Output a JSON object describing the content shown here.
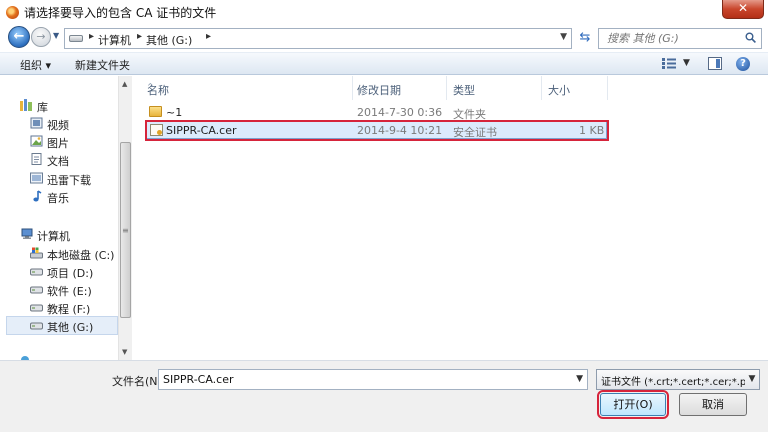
{
  "window": {
    "title": "请选择要导入的包含 CA 证书的文件",
    "close_label": "✕"
  },
  "address_bar": {
    "breadcrumbs": [
      "计算机",
      "其他 (G:)"
    ],
    "search_placeholder": "搜索 其他 (G:)"
  },
  "command_bar": {
    "organize_label": "组织 ▾",
    "new_folder_label": "新建文件夹"
  },
  "navigation": {
    "library_label": "库",
    "libraries": [
      "视频",
      "图片",
      "文档",
      "迅雷下载",
      "音乐"
    ],
    "computer_label": "计算机",
    "drives": [
      "本地磁盘 (C:)",
      "项目 (D:)",
      "软件 (E:)",
      "教程 (F:)",
      "其他 (G:)"
    ],
    "selected_drive": "其他 (G:)"
  },
  "file_list": {
    "columns": [
      "名称",
      "修改日期",
      "类型",
      "大小"
    ],
    "rows": [
      {
        "name": "~1",
        "modified": "2014-7-30 0:36",
        "type": "文件夹",
        "size": "",
        "icon": "folder-icon"
      },
      {
        "name": "SIPPR-CA.cer",
        "modified": "2014-9-4 10:21",
        "type": "安全证书",
        "size": "1 KB",
        "icon": "certificate-icon",
        "selected": true
      }
    ]
  },
  "footer": {
    "filename_label": "文件名(N):",
    "filename_value": "SIPPR-CA.cer",
    "filetype_value": "证书文件 (*.crt;*.cert;*.cer;*.pem)",
    "open_label": "打开(O)",
    "cancel_label": "取消"
  },
  "colors": {
    "highlight": "#d6243b",
    "selection": "#dcebfc",
    "toolbar": "#dde7f2"
  }
}
